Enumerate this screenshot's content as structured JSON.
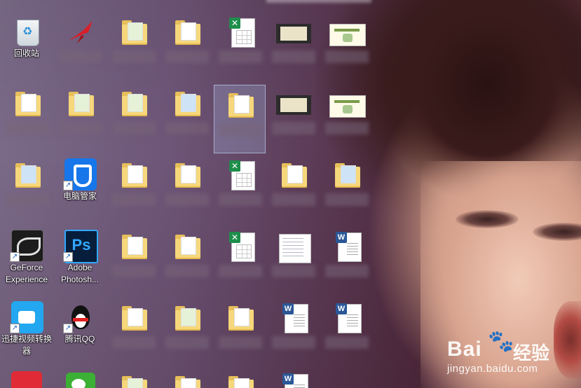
{
  "desktop": {
    "icons": [
      {
        "key": "recycle_bin",
        "label": "回收站"
      },
      {
        "key": "pc_manager",
        "label": "电脑管家"
      },
      {
        "key": "geforce",
        "label": "GeForce Experience"
      },
      {
        "key": "photoshop",
        "label": "Adobe Photosh..."
      },
      {
        "key": "xunjie",
        "label": "迅捷视频转换器"
      },
      {
        "key": "qq",
        "label": "腾讯QQ"
      }
    ]
  },
  "watermark": {
    "logo": "Bai",
    "logo_paw": "🐾",
    "name": "经验",
    "url": "jingyan.baidu.com"
  },
  "colors": {
    "folder": "#f6d77b",
    "excel": "#1e8e4b",
    "word": "#2b5797",
    "selection": "#aabee6"
  }
}
